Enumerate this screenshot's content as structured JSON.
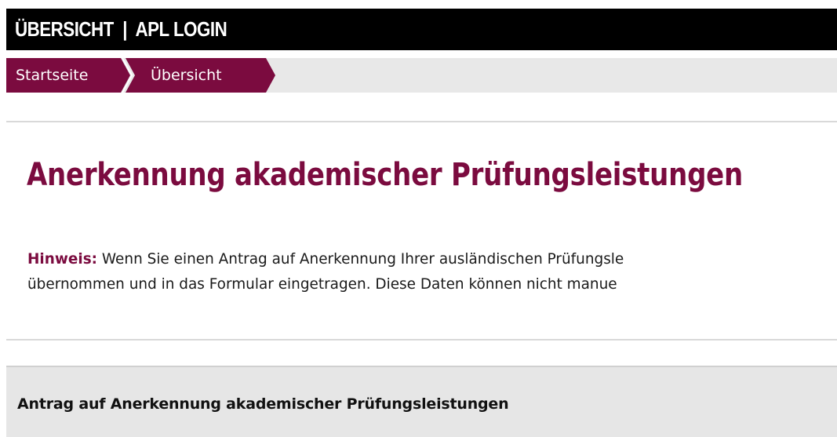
{
  "header": {
    "nav_item_1": "ÜBERSICHT",
    "separator": "|",
    "nav_item_2": "APL LOGIN"
  },
  "breadcrumb": {
    "items": [
      {
        "label": "Startseite"
      },
      {
        "label": "Übersicht"
      }
    ]
  },
  "main": {
    "title": "Anerkennung akademischer Prüfungsleistungen",
    "notice": {
      "label": "Hinweis:",
      "line1": " Wenn Sie einen Antrag auf Anerkennung Ihrer ausländischen Prüfungsle",
      "line2": "übernommen und in das Formular eingetragen. Diese Daten können nicht manue"
    }
  },
  "section": {
    "heading": "Antrag auf Anerkennung akademischer Prüfungsleistungen"
  },
  "colors": {
    "brand": "#7b0b3f",
    "header_bg": "#000000",
    "breadcrumb_bg": "#e8e8e8",
    "section_bg": "#e6e6e6"
  }
}
